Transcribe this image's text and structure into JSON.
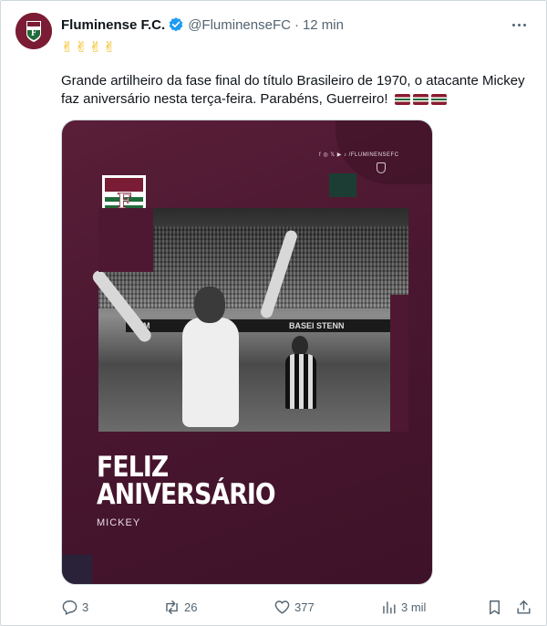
{
  "tweet": {
    "display_name": "Fluminense F.C.",
    "handle": "@FluminenseFC",
    "separator": "·",
    "time": "12 min",
    "emoji_line": "✌✌✌✌",
    "text": "Grande artilheiro da fase final do título Brasileiro de 1970, o atacante Mickey faz aniversário nesta terça-feira. Parabéns, Guerreiro!",
    "flags": [
      "fluminense-flag",
      "fluminense-flag",
      "fluminense-flag"
    ]
  },
  "media": {
    "social_handle": "f ◎ 𝕏 ▶ ♪ /FLUMINENSEFC",
    "board_text": "CAM",
    "board_text_2": "BASEI STENN",
    "headline_line1": "FELIZ",
    "headline_line2": "ANIVERSÁRIO",
    "honoree": "MICKEY"
  },
  "actions": {
    "replies": "3",
    "reposts": "26",
    "likes": "377",
    "views": "3 mil"
  },
  "colors": {
    "accent_blue": "#1d9bf0",
    "muted": "#536471",
    "club_maroon": "#7a1c33",
    "club_green": "#1f6b3a"
  }
}
